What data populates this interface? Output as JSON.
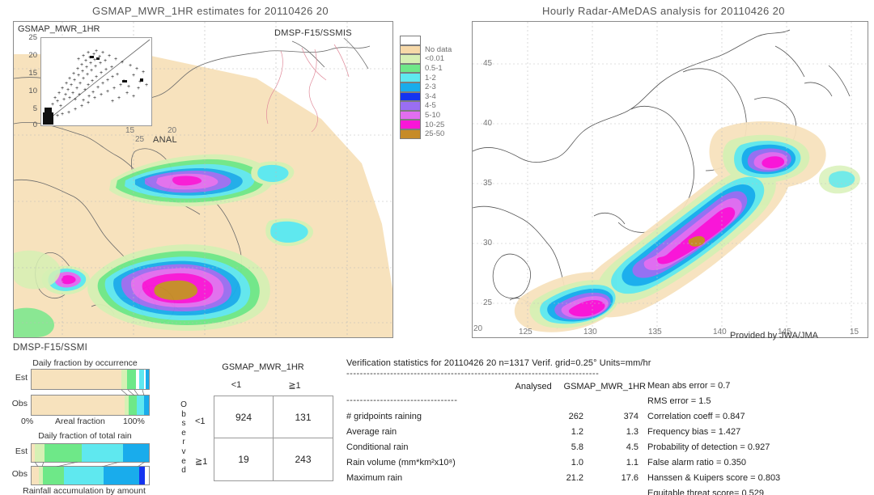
{
  "panels": {
    "left_map_title": "GSMAP_MWR_1HR estimates for 20110426 20",
    "right_map_title": "Hourly Radar-AMeDAS analysis for 20110426 20",
    "left_map_inner_label": "GSMAP_MWR_1HR",
    "left_map_sensor_label": "DMSP-F15/SSMIS",
    "left_map_anal_label": "ANAL",
    "left_map_bottom_label": "DMSP-F15/SSMI",
    "right_map_credit": "Provided by JWA/JMA"
  },
  "legend": {
    "title": "",
    "entries": [
      {
        "label": "",
        "color": "#ffffff"
      },
      {
        "label": "No data",
        "color": "#f7d9a8"
      },
      {
        "label": "<0.01",
        "color": "#d6f0b4"
      },
      {
        "label": "0.5-1",
        "color": "#6ee888"
      },
      {
        "label": "1-2",
        "color": "#5fe8ef"
      },
      {
        "label": "2-3",
        "color": "#19acec"
      },
      {
        "label": "3-4",
        "color": "#1434f0"
      },
      {
        "label": "4-5",
        "color": "#9a6ef2"
      },
      {
        "label": "5-10",
        "color": "#e26ef0"
      },
      {
        "label": "10-25",
        "color": "#f916d8"
      },
      {
        "label": "25-50",
        "color": "#c68b28"
      }
    ]
  },
  "scatter": {
    "title": "GSMAP_MWR_1HR",
    "y_ticks": [
      "25",
      "20",
      "15",
      "10",
      "5",
      "0"
    ],
    "x_range": [
      0,
      25
    ],
    "y_range": [
      0,
      25
    ]
  },
  "left_map_axes": {
    "x_ticks": [
      "15",
      "20",
      "25"
    ],
    "y_ticks": [
      "25"
    ]
  },
  "right_map_axes": {
    "x_ticks": [
      "125",
      "130",
      "135",
      "140",
      "145",
      "15"
    ],
    "y_ticks": [
      "45",
      "40",
      "35",
      "30",
      "25",
      "20"
    ],
    "origin_label": "20"
  },
  "bars": {
    "panel_label": "DMSP-F15/SSMI",
    "chart1": {
      "title": "Daily fraction by occurrence",
      "row_labels": [
        "Est",
        "Obs"
      ],
      "axis_left": "0%",
      "axis_center": "Areal fraction",
      "axis_right": "100%",
      "est_segments": [
        {
          "color": "#f7e2bd",
          "pct": 76.5
        },
        {
          "color": "#d6f0b4",
          "pct": 5.0
        },
        {
          "color": "#6ee888",
          "pct": 7.5
        },
        {
          "color": "#ffffff",
          "pct": 3.0
        },
        {
          "color": "#5fe8ef",
          "pct": 4.0
        },
        {
          "color": "#ffffff",
          "pct": 1.5
        },
        {
          "color": "#19acec",
          "pct": 2.5
        }
      ],
      "obs_segments": [
        {
          "color": "#f7e2bd",
          "pct": 79.0
        },
        {
          "color": "#d6f0b4",
          "pct": 4.0
        },
        {
          "color": "#6ee888",
          "pct": 6.5
        },
        {
          "color": "#5fe8ef",
          "pct": 6.5
        },
        {
          "color": "#19acec",
          "pct": 4.0
        }
      ]
    },
    "chart2": {
      "title": "Daily fraction of total rain",
      "row_labels": [
        "Est",
        "Obs"
      ],
      "caption": "Rainfall accumulation by amount",
      "est_segments": [
        {
          "color": "#f7e2bd",
          "pct": 3.0
        },
        {
          "color": "#d6f0b4",
          "pct": 8.0
        },
        {
          "color": "#6ee888",
          "pct": 32.0
        },
        {
          "color": "#5fe8ef",
          "pct": 35.0
        },
        {
          "color": "#19acec",
          "pct": 22.0
        }
      ],
      "obs_segments": [
        {
          "color": "#f7e2bd",
          "pct": 6.0
        },
        {
          "color": "#d6f0b4",
          "pct": 3.5
        },
        {
          "color": "#6ee888",
          "pct": 18.0
        },
        {
          "color": "#5fe8ef",
          "pct": 34.0
        },
        {
          "color": "#19acec",
          "pct": 30.0
        },
        {
          "color": "#1434f0",
          "pct": 5.0
        },
        {
          "color": "#ffffff",
          "pct": 3.5
        }
      ]
    }
  },
  "contingency": {
    "title": "GSMAP_MWR_1HR",
    "col_headers": [
      "<1",
      "≧1"
    ],
    "row_headers": [
      "<1",
      "≧1"
    ],
    "side_label": "Observed",
    "values": [
      [
        "924",
        "131"
      ],
      [
        "19",
        "243"
      ]
    ]
  },
  "stats": {
    "header": "Verification statistics for 20110426 20  n=1317  Verif. grid=0.25°  Units=mm/hr",
    "rule": "---------------------------------------------------------------------------",
    "sub_rule": "---------------------------------",
    "col_headers": [
      "",
      "Analysed",
      "GSMAP_MWR_1HR"
    ],
    "rows": [
      {
        "label": "# gridpoints raining",
        "analysed": "262",
        "estimate": "374"
      },
      {
        "label": "Average rain",
        "analysed": "1.2",
        "estimate": "1.3"
      },
      {
        "label": "Conditional rain",
        "analysed": "5.8",
        "estimate": "4.5"
      },
      {
        "label": "Rain volume (mm*km²x10⁸)",
        "analysed": "1.0",
        "estimate": "1.1"
      },
      {
        "label": "Maximum rain",
        "analysed": "21.2",
        "estimate": "17.6"
      }
    ],
    "scores": [
      "Mean abs error = 0.7",
      "RMS error = 1.5",
      "Correlation coeff = 0.847",
      "Frequency bias = 1.427",
      "Probability of detection = 0.927",
      "False alarm ratio = 0.350",
      "Hanssen & Kuipers score = 0.803",
      "Equitable threat score= 0.529"
    ]
  },
  "chart_data": {
    "type": "table",
    "title": "Verification statistics for 20110426 20",
    "n": 1317,
    "verif_grid_deg": 0.25,
    "units": "mm/hr",
    "contingency_table": {
      "rows": [
        "Observed <1",
        "Observed ≥1"
      ],
      "cols": [
        "GSMAP_MWR_1HR <1",
        "GSMAP_MWR_1HR ≥1"
      ],
      "values": [
        [
          924,
          131
        ],
        [
          19,
          243
        ]
      ]
    },
    "comparison": {
      "categories": [
        "# gridpoints raining",
        "Average rain",
        "Conditional rain",
        "Rain volume (mm*km2x10^8)",
        "Maximum rain"
      ],
      "series": [
        {
          "name": "Analysed",
          "values": [
            262,
            1.2,
            5.8,
            1.0,
            21.2
          ]
        },
        {
          "name": "GSMAP_MWR_1HR",
          "values": [
            374,
            1.3,
            4.5,
            1.1,
            17.6
          ]
        }
      ]
    },
    "scores": {
      "mean_abs_error": 0.7,
      "rms_error": 1.5,
      "correlation_coeff": 0.847,
      "frequency_bias": 1.427,
      "probability_of_detection": 0.927,
      "false_alarm_ratio": 0.35,
      "hanssen_kuipers_score": 0.803,
      "equitable_threat_score": 0.529
    },
    "rain_rate_legend_bins": [
      "No data",
      "<0.01",
      "0.5-1",
      "1-2",
      "2-3",
      "3-4",
      "4-5",
      "5-10",
      "10-25",
      "25-50"
    ],
    "daily_fraction_by_occurrence": {
      "Est": [
        76.5,
        5.0,
        7.5,
        3.0,
        4.0,
        1.5,
        2.5
      ],
      "Obs": [
        79.0,
        4.0,
        6.5,
        6.5,
        4.0
      ]
    },
    "daily_fraction_of_total_rain": {
      "Est": [
        3.0,
        8.0,
        32.0,
        35.0,
        22.0
      ],
      "Obs": [
        6.0,
        3.5,
        18.0,
        34.0,
        30.0,
        5.0,
        3.5
      ]
    }
  }
}
